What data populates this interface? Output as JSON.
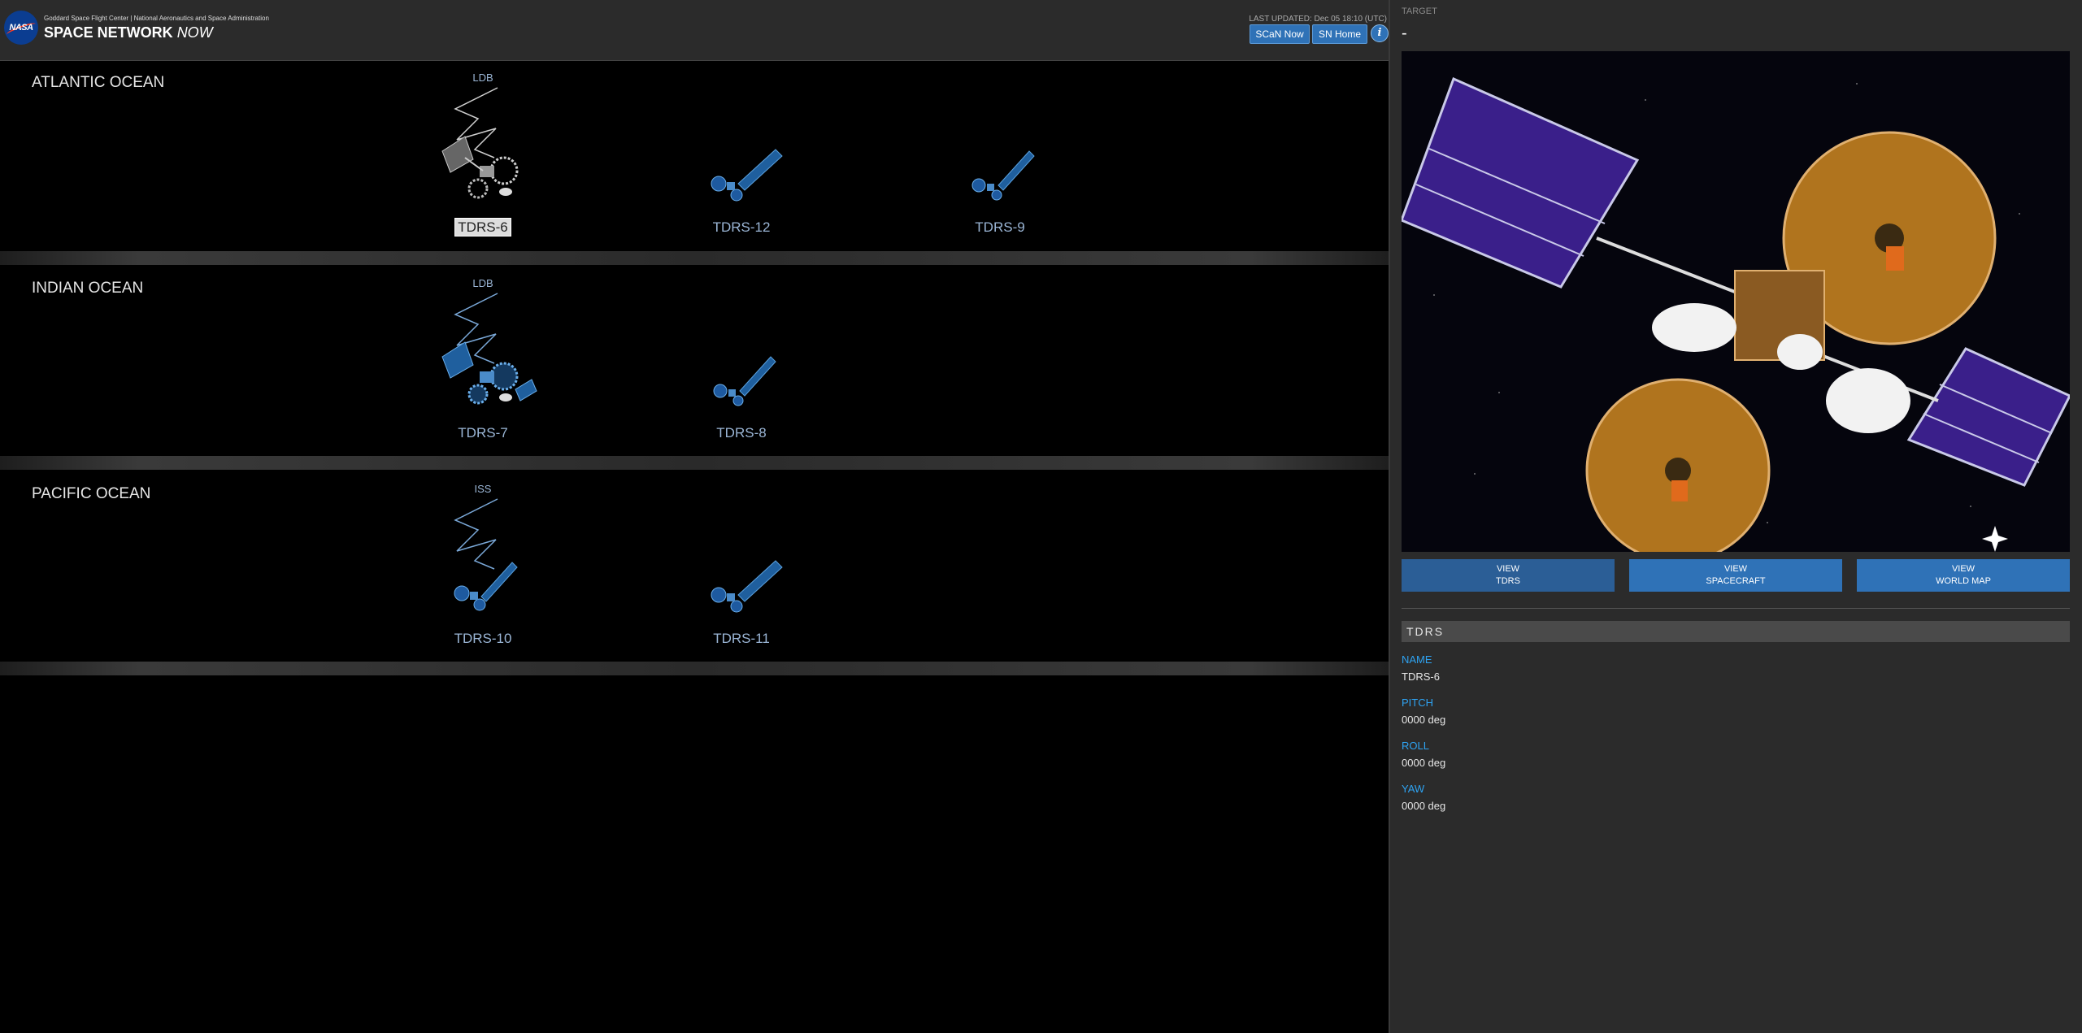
{
  "header": {
    "org": "Goddard Space Flight Center | National Aeronautics and Space Administration",
    "title": "SPACE NETWORK",
    "title_suffix": "NOW",
    "logo_text": "NASA",
    "last_updated": "LAST UPDATED: Dec 05 18:10 (UTC)",
    "scan_now_label": "SCaN Now",
    "sn_home_label": "SN Home",
    "info_label": "i"
  },
  "regions": [
    {
      "name": "ATLANTIC OCEAN",
      "satellites": [
        {
          "name": "TDRS-6",
          "link": "LDB",
          "selected": true
        },
        {
          "name": "TDRS-12",
          "link": ""
        },
        {
          "name": "TDRS-9",
          "link": ""
        }
      ]
    },
    {
      "name": "INDIAN OCEAN",
      "satellites": [
        {
          "name": "TDRS-7",
          "link": "LDB"
        },
        {
          "name": "TDRS-8",
          "link": ""
        }
      ]
    },
    {
      "name": "PACIFIC OCEAN",
      "satellites": [
        {
          "name": "TDRS-10",
          "link": "ISS"
        },
        {
          "name": "TDRS-11",
          "link": ""
        }
      ]
    }
  ],
  "panel": {
    "target_label": "TARGET",
    "target_value": "-",
    "buttons": [
      {
        "line1": "VIEW",
        "line2": "TDRS"
      },
      {
        "line1": "VIEW",
        "line2": "SPACECRAFT"
      },
      {
        "line1": "VIEW",
        "line2": "WORLD MAP"
      }
    ],
    "section_title": "TDRS",
    "fields": [
      {
        "label": "NAME",
        "value": "TDRS-6"
      },
      {
        "label": "PITCH",
        "value": "0000 deg"
      },
      {
        "label": "ROLL",
        "value": "0000 deg"
      },
      {
        "label": "YAW",
        "value": "0000 deg"
      }
    ]
  },
  "colors": {
    "accent_blue": "#2f72b7",
    "field_label": "#2ea3f2",
    "sat_label": "#9bb6d6"
  },
  "icons": [
    "nasa-logo",
    "info-icon",
    "satellite-icon",
    "link-lightning-icon"
  ]
}
